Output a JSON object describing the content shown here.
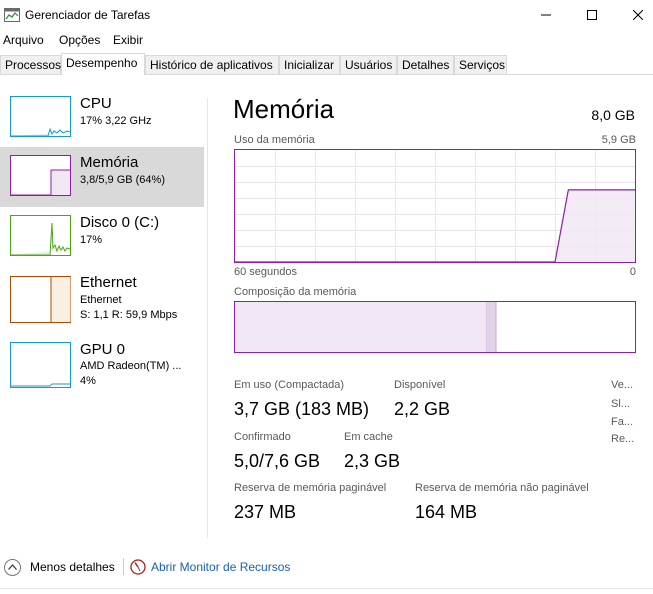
{
  "window": {
    "title": "Gerenciador de Tarefas",
    "minimize": "—",
    "maximize": "☐",
    "close": "✕"
  },
  "menu": [
    "Arquivo",
    "Opções",
    "Exibir"
  ],
  "tabs": [
    "Processos",
    "Desempenho",
    "Histórico de aplicativos",
    "Inicializar",
    "Usuários",
    "Detalhes",
    "Serviços"
  ],
  "sidebar": {
    "items": [
      {
        "title": "CPU",
        "sub1": "17%  3,22 GHz",
        "color": "#1a9acb",
        "icon": "cpu-graph-icon"
      },
      {
        "title": "Memória",
        "sub1": "3,8/5,9 GB (64%)",
        "color": "#8b1fa8",
        "icon": "memory-graph-icon"
      },
      {
        "title": "Disco 0 (C:)",
        "sub1": "17%",
        "color": "#4da619",
        "icon": "disk-graph-icon"
      },
      {
        "title": "Ethernet",
        "sub1": "Ethernet",
        "sub2": "S: 1,1  R: 59,9 Mbps",
        "color": "#a74f01",
        "icon": "ethernet-graph-icon"
      },
      {
        "title": "GPU 0",
        "sub1": "AMD Radeon(TM) ...",
        "sub2": "4%",
        "color": "#1a9acb",
        "icon": "gpu-graph-icon"
      }
    ]
  },
  "main": {
    "title": "Memória",
    "total": "8,0 GB",
    "usage_label": "Uso da memória",
    "usage_max": "5,9 GB",
    "x_left": "60 segundos",
    "x_right": "0",
    "composition_label": "Composição da memória",
    "accent": "#8b1fa8"
  },
  "chart_data": {
    "type": "area",
    "title": "Uso da memória",
    "xlabel": "60 segundos",
    "ylabel": "",
    "ylim": [
      0,
      5.9
    ],
    "x": [
      60,
      50,
      40,
      30,
      20,
      12,
      10,
      0
    ],
    "values": [
      0,
      0,
      0,
      0,
      0,
      0,
      3.8,
      3.8
    ],
    "composition": {
      "in_use_fraction": 0.63,
      "modified_fraction": 0.02,
      "standby_fraction": 0.0
    }
  },
  "stats": {
    "in_use_label": "Em uso (Compactada)",
    "in_use": "3,7 GB (183 MB)",
    "available_label": "Disponível",
    "available": "2,2 GB",
    "committed_label": "Confirmado",
    "committed": "5,0/7,6 GB",
    "cached_label": "Em cache",
    "cached": "2,3 GB",
    "paged_label": "Reserva de memória paginável",
    "paged": "237 MB",
    "nonpaged_label": "Reserva de memória não paginável",
    "nonpaged": "164 MB",
    "right_labels": [
      "Ve...",
      "Sl...",
      "Fa...",
      "Re..."
    ]
  },
  "footer": {
    "less_details": "Menos detalhes",
    "open_monitor": "Abrir Monitor de Recursos"
  }
}
